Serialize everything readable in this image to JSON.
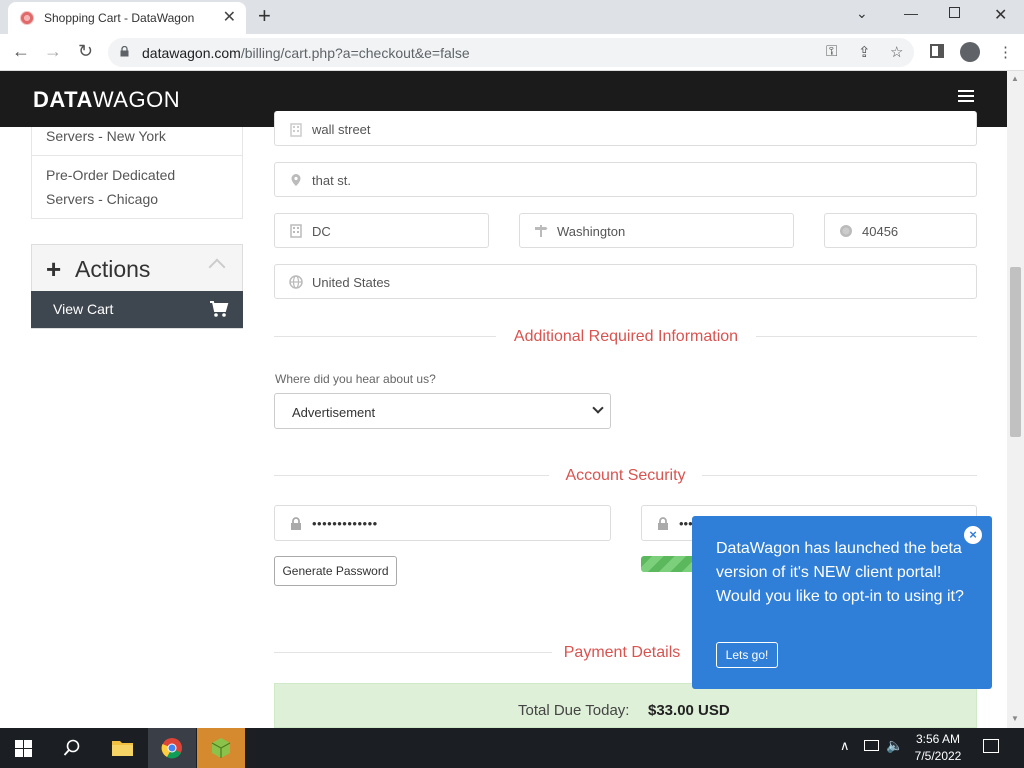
{
  "browser": {
    "tab_title": "Shopping Cart - DataWagon",
    "url_host": "datawagon.com",
    "url_path": "/billing/cart.php?a=checkout&e=false"
  },
  "site": {
    "logo_bold": "DATA",
    "logo_regular": "WAGON"
  },
  "sidebar": {
    "items": [
      {
        "label_line1": "Servers - New York"
      },
      {
        "label_line1": "Pre-Order Dedicated",
        "label_line2": "Servers - Chicago"
      }
    ],
    "actions_title": "Actions",
    "view_cart": "View Cart"
  },
  "address": {
    "street1": "wall street",
    "street2": "that st.",
    "city": "DC",
    "state": "Washington",
    "postcode": "40456",
    "country": "United States"
  },
  "additional": {
    "heading": "Additional Required Information",
    "hear_label": "Where did you hear about us?",
    "hear_value": "Advertisement"
  },
  "security": {
    "heading": "Account Security",
    "password_mask": "•••••••••••••",
    "confirm_mask": "•••",
    "generate_label": "Generate Password"
  },
  "payment": {
    "heading": "Payment Details",
    "total_label": "Total Due Today:",
    "total_amount": "$33.00 USD"
  },
  "popup": {
    "message": "DataWagon has launched the beta version of it's NEW client portal! Would you like to opt-in to using it?",
    "button": "Lets go!",
    "close": "×"
  },
  "taskbar": {
    "time": "3:56 AM",
    "date": "7/5/2022"
  }
}
